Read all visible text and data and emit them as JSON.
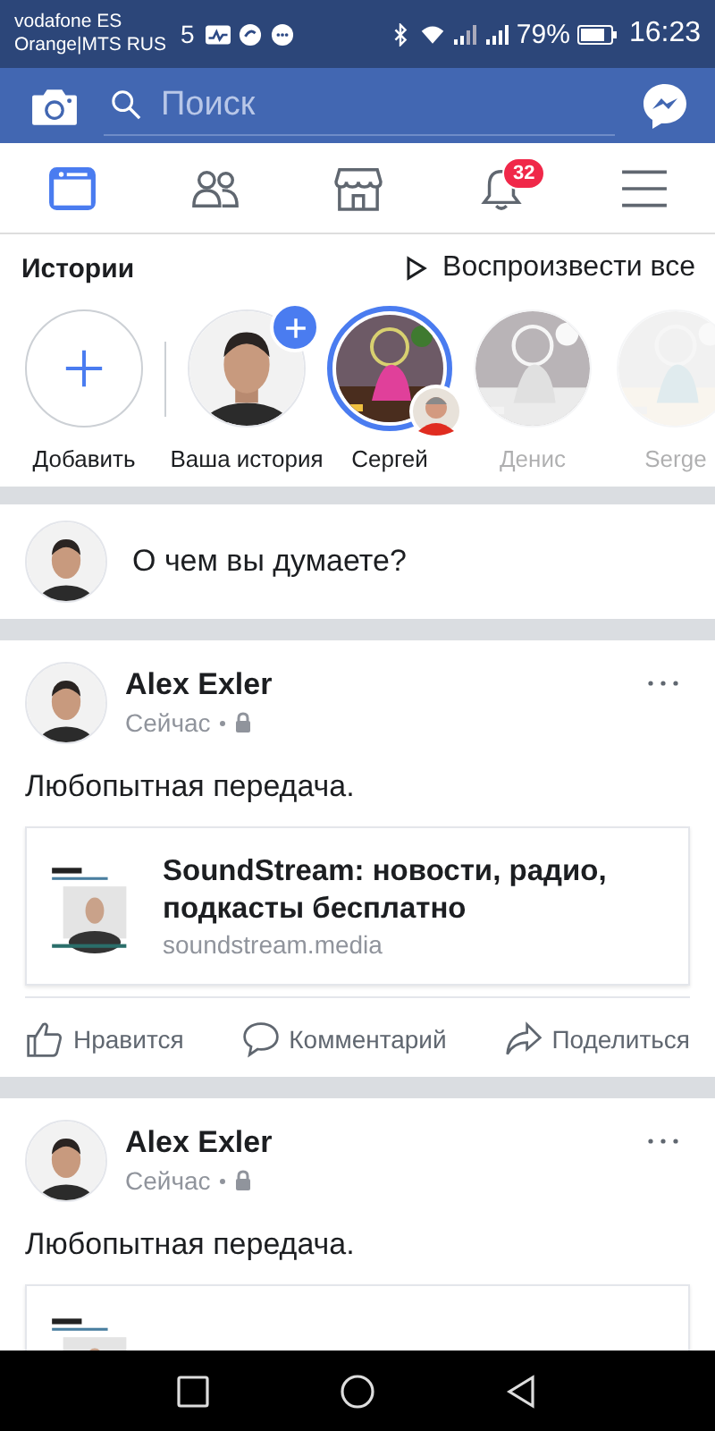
{
  "status_bar": {
    "carriers": [
      "vodafone ES",
      "Orange|MTS RUS"
    ],
    "network": "5",
    "battery": "79%",
    "time": "16:23"
  },
  "header": {
    "search": {
      "placeholder": "Поиск"
    }
  },
  "nav_tabs": [
    {
      "kind": "feed",
      "selected": true
    },
    {
      "kind": "friends",
      "selected": false
    },
    {
      "kind": "market",
      "selected": false
    },
    {
      "kind": "notifications",
      "selected": false,
      "badge": "32"
    },
    {
      "kind": "menu",
      "selected": false
    }
  ],
  "stories": {
    "title": "Истории",
    "play_all": "Воспроизвести все",
    "items": [
      {
        "kind": "add",
        "label": "Добавить"
      },
      {
        "kind": "own",
        "label": "Ваша история"
      },
      {
        "kind": "story",
        "label": "Сергей",
        "seen": false
      },
      {
        "kind": "story",
        "label": "Денис",
        "seen": true
      },
      {
        "kind": "story",
        "label": "Serge",
        "seen": true
      }
    ]
  },
  "composer": {
    "placeholder": "О чем вы думаете?"
  },
  "posts": [
    {
      "author": "Alex Exler",
      "time": "Сейчас",
      "text": "Любопытная передача.",
      "link": {
        "title": "SoundStream: новости, радио, подкасты бесплатно",
        "domain": "soundstream.media"
      },
      "actions": [
        "Нравится",
        "Комментарий",
        "Поделиться"
      ]
    },
    {
      "author": "Alex Exler",
      "time": "Сейчас",
      "text": "Любопытная передача."
    }
  ]
}
